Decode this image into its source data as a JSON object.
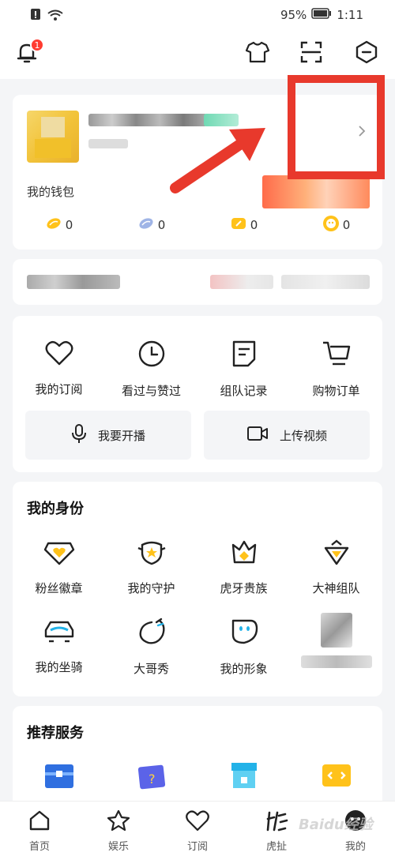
{
  "status_bar": {
    "battery": "95%",
    "time": "1:11"
  },
  "notification": {
    "badge_count": "1"
  },
  "wallet": {
    "label": "我的钱包",
    "items": [
      {
        "icon": "gold-bean-icon",
        "value": "0"
      },
      {
        "icon": "silver-bean-icon",
        "value": "0"
      },
      {
        "icon": "ticket-icon",
        "value": "0"
      },
      {
        "icon": "coin-icon",
        "value": "0"
      }
    ]
  },
  "shortcuts": [
    {
      "icon": "heart-icon",
      "label": "我的订阅"
    },
    {
      "icon": "clock-icon",
      "label": "看过与赞过"
    },
    {
      "icon": "document-icon",
      "label": "组队记录"
    },
    {
      "icon": "cart-icon",
      "label": "购物订单"
    }
  ],
  "actions": [
    {
      "icon": "microphone-icon",
      "label": "我要开播"
    },
    {
      "icon": "video-camera-icon",
      "label": "上传视频"
    }
  ],
  "identity": {
    "title": "我的身份",
    "items": [
      {
        "icon": "fan-badge-icon",
        "label": "粉丝徽章"
      },
      {
        "icon": "guard-shield-icon",
        "label": "我的守护"
      },
      {
        "icon": "crown-icon",
        "label": "虎牙贵族"
      },
      {
        "icon": "team-crown-icon",
        "label": "大神组队"
      },
      {
        "icon": "car-icon",
        "label": "我的坐骑"
      },
      {
        "icon": "show-icon",
        "label": "大哥秀"
      },
      {
        "icon": "avatar-shape-icon",
        "label": "我的形象"
      }
    ]
  },
  "services": {
    "title": "推荐服务"
  },
  "tabs": [
    {
      "icon": "home-icon",
      "label": "首页"
    },
    {
      "icon": "star-icon",
      "label": "娱乐"
    },
    {
      "icon": "heart-icon",
      "label": "订阅"
    },
    {
      "icon": "huya-icon",
      "label": "虎扯"
    },
    {
      "icon": "profile-icon",
      "label": "我的"
    }
  ],
  "watermark": "Baidu经验",
  "colors": {
    "annotation_red": "#e8392c",
    "accent_yellow": "#ffc21a"
  }
}
